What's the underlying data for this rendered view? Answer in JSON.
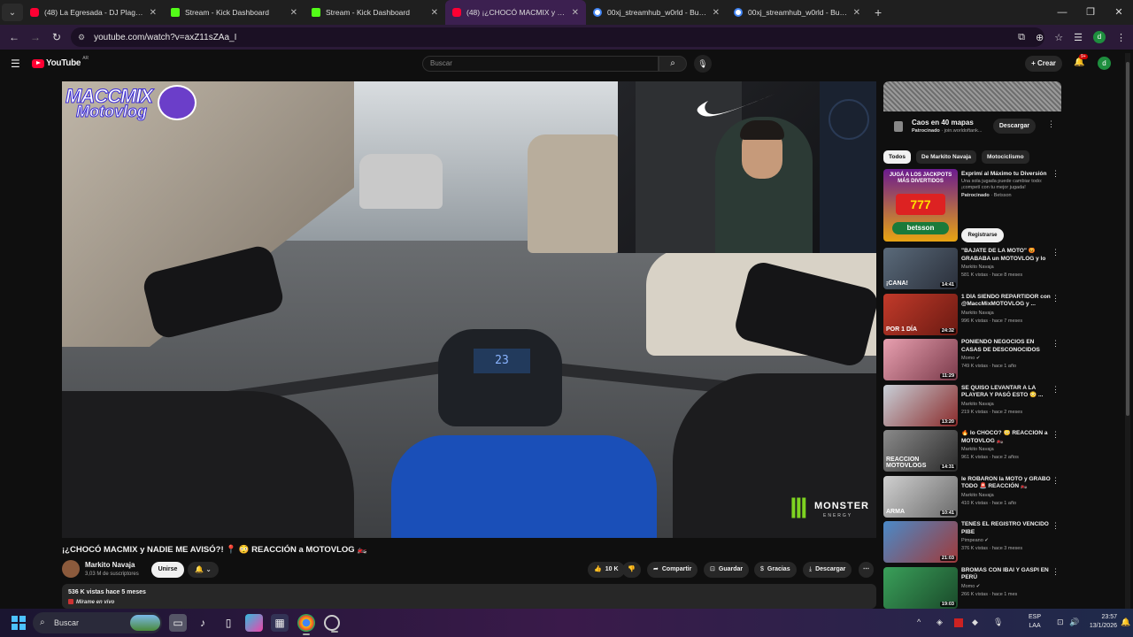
{
  "browser": {
    "tabs": [
      {
        "label": "(48) La Egresada - DJ Plaga, El T",
        "favicon": "yt",
        "active": false
      },
      {
        "label": "Stream - Kick Dashboard",
        "favicon": "kick",
        "active": false
      },
      {
        "label": "Stream - Kick Dashboard",
        "favicon": "kick",
        "active": false
      },
      {
        "label": "(48) ¡¿CHOCÓ MACMIX y NADIE",
        "favicon": "yt",
        "active": true
      },
      {
        "label": "00xj_streamhub_w0rld - Buscar",
        "favicon": "g",
        "active": false
      },
      {
        "label": "00xj_streamhub_w0rld - Buscar",
        "favicon": "g",
        "active": false
      }
    ],
    "url": "youtube.com/watch?v=axZ11sZAa_I",
    "profile_initial": "d"
  },
  "youtube": {
    "logo_word": "YouTube",
    "country": "AR",
    "search_placeholder": "Buscar",
    "create_label": "Crear",
    "notif_count": "9+",
    "avatar_initial": "d"
  },
  "video": {
    "overlay_logo_1": "MACCMIX",
    "overlay_logo_2": "Motovlog",
    "speedo": "23",
    "sponsor_word": "MONSTER",
    "sponsor_sub": "ENERGY",
    "title": "¡¿CHOCÓ MACMIX y NADIE ME AVISÓ?! 📍 😳 REACCIÓN a MOTOVLOG 🏍️",
    "channel_name": "Markito Navaja",
    "subscribers": "3,03 M de suscriptores",
    "join_label": "Unirse",
    "likes": "10 K",
    "share_label": "Compartir",
    "save_label": "Guardar",
    "thanks_label": "Gracias",
    "download_label": "Descargar",
    "views_line": "536 K vistas  hace 5 meses",
    "live_line": "Mírame en vivo"
  },
  "sidebar": {
    "ad": {
      "title": "Caos en 40 mapas",
      "sponsored": "Patrocinado",
      "domain": "join.worldoftank...",
      "button": "Descargar"
    },
    "chips": [
      "Todos",
      "De Markito Navaja",
      "Motociclismo"
    ],
    "promo": {
      "thumb_text": "JUGÁ A LOS JACKPOTS MÁS DIVERTIDOS",
      "slot": "777",
      "brand": "betsson",
      "title": "Exprimí al Máximo tu Diversión",
      "desc": "Una sola jugada puede cambiar todo: ¡competí con tu mejor jugada!",
      "sponsored": "Patrocinado",
      "advertiser": "Betsson",
      "button": "Registrarse"
    },
    "videos": [
      {
        "title": "\"BAJATE DE LA MOTO\" 😡 GRABABA un MOTOVLOG y lo ...",
        "channel": "Markito Navaja",
        "meta": "581 K vistas · hace 8 meses",
        "duration": "14:41",
        "thumb_text": "¡CANA!",
        "color1": "#5a6a7a",
        "color2": "#2a2f3a"
      },
      {
        "title": "1 DÍA SIENDO REPARTIDOR con @MaccMixMOTOVLOG y ...",
        "channel": "Markito Navaja",
        "meta": "996 K vistas · hace 7 meses",
        "duration": "24:32",
        "thumb_text": "POR 1 DÍA",
        "color1": "#c23a2a",
        "color2": "#6a1a12"
      },
      {
        "title": "PONIENDO NEGOCIOS EN CASAS DE DESCONOCIDOS",
        "channel": "Momo ✔",
        "meta": "749 K vistas · hace 1 año",
        "duration": "11:29",
        "thumb_text": "",
        "color1": "#e8a0b0",
        "color2": "#7a3a4a"
      },
      {
        "title": "SE QUISO LEVANTAR A LA PLAYERA Y PASÓ ESTO 😳 ...",
        "channel": "Markito Navaja",
        "meta": "219 K vistas · hace 2 meses",
        "duration": "13:20",
        "thumb_text": "",
        "color1": "#c8d0d8",
        "color2": "#8a2a2a"
      },
      {
        "title": "🔥 lo CHOCÓ? 😳 REACCIÓN a MOTOVLOG 🏍️",
        "channel": "Markito Navaja",
        "meta": "961 K vistas · hace 2 años",
        "duration": "14:31",
        "thumb_text": "REACCION MOTOVLOGS",
        "color1": "#8a8a8a",
        "color2": "#2a2a2a"
      },
      {
        "title": "le ROBARON la MOTO y GRABÓ TODO 🚨 REACCIÓN 🏍️",
        "channel": "Markito Navaja",
        "meta": "410 K vistas · hace 1 año",
        "duration": "10:41",
        "thumb_text": "ARMA",
        "color1": "#d0d0d0",
        "color2": "#6a6a6a"
      },
      {
        "title": "TENÉS EL REGISTRO VENCIDO PIBE",
        "channel": "Pimpeano ✔",
        "meta": "376 K vistas · hace 3 meses",
        "duration": "21:03",
        "thumb_text": "",
        "color1": "#4a8ac8",
        "color2": "#a03a3a"
      },
      {
        "title": "BROMAS CON IBAI Y GASPI EN PERÚ",
        "channel": "Momo ✔",
        "meta": "266 K vistas · hace 1 mes",
        "duration": "19:03",
        "thumb_text": "",
        "color1": "#3aa05a",
        "color2": "#1a4a2a"
      }
    ]
  },
  "taskbar": {
    "search_label": "Buscar",
    "lang_1": "ESP",
    "lang_2": "LAA",
    "time": "23:57",
    "date": "13/1/2026"
  }
}
